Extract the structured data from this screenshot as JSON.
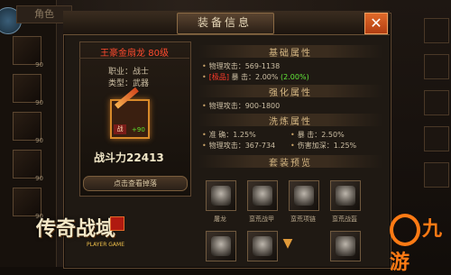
{
  "left_panel": {
    "tab_label": "角色",
    "slot_levels": [
      "90",
      "90",
      "90",
      "90",
      "90"
    ]
  },
  "window": {
    "title": "装备信息",
    "close_glyph": "✕"
  },
  "item": {
    "name": "王豪金扇龙 80级",
    "profession_label": "职业：",
    "profession_value": "战士",
    "type_label": "类型：",
    "type_value": "武器",
    "tag": "战",
    "enhance": "+90",
    "power_label": "战斗力",
    "power_value": "22413",
    "chase_button": "点击查看掉落"
  },
  "sections": {
    "base": "基础属性",
    "strengthen": "强化属性",
    "refine": "洗炼属性",
    "set": "套装预览"
  },
  "base_stats": {
    "row1": "物理攻击：569-1138",
    "row2_tag": "[极品]",
    "row2_label": "暴    击：2.00%",
    "row2_bonus": "(2.00%)"
  },
  "strengthen_stats": {
    "row1": "物理攻击：900-1800"
  },
  "refine_stats": {
    "r1c1": "准    确：1.25%",
    "r1c2": "暴    击：2.50%",
    "r2c1": "物理攻击：367-734",
    "r2c2": "伤害加深：1.25%"
  },
  "set_preview": {
    "items": [
      "屠龙",
      "蛮荒战甲",
      "蛮荒项链",
      "蛮荒战盔"
    ]
  },
  "logo": {
    "text": "传奇战域",
    "sub": "PLAYER GAME"
  },
  "watermark": {
    "text": "九游"
  },
  "colors": {
    "accent": "#e06a2a",
    "excellent": "#ff3a2a",
    "bonus": "#63e93a",
    "item_name": "#ff4b2e"
  }
}
